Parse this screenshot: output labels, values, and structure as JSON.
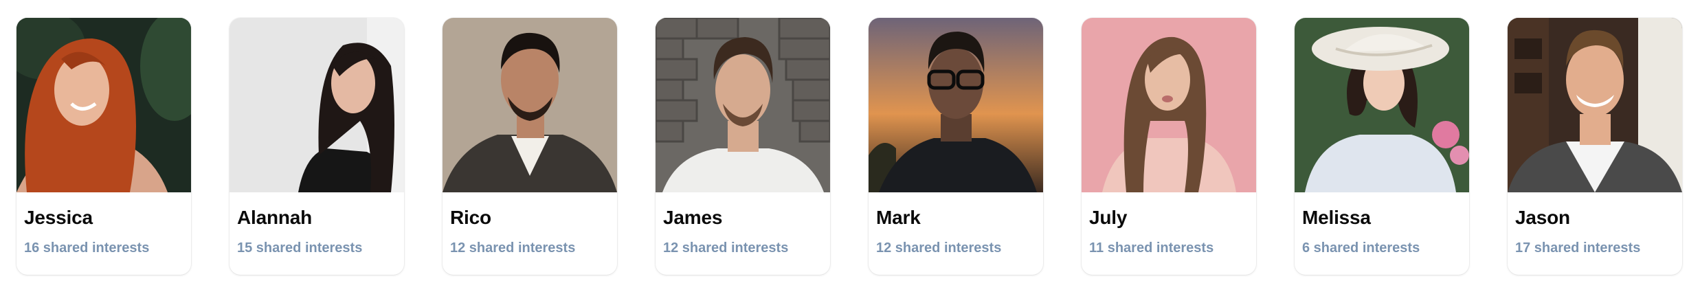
{
  "profiles": [
    {
      "name": "Jessica",
      "interests": "16 shared interests",
      "bg": "#1d2b22",
      "hair": "#b5471c",
      "skin": "#e9b79a",
      "top": "#d8a48a"
    },
    {
      "name": "Alannah",
      "interests": "15 shared interests",
      "bg": "#e6e6e6",
      "hair": "#1f1715",
      "skin": "#e4b9a3",
      "top": "#161616"
    },
    {
      "name": "Rico",
      "interests": "12 shared interests",
      "bg": "#b3a595",
      "hair": "#18120f",
      "skin": "#b98467",
      "top": "#3a3632"
    },
    {
      "name": "James",
      "interests": "12 shared interests",
      "bg": "#6b6864",
      "hair": "#3c2a1f",
      "skin": "#d6aa8f",
      "top": "#eeeeec"
    },
    {
      "name": "Mark",
      "interests": "12 shared interests",
      "bg": "#c97d45",
      "hair": "#1c1612",
      "skin": "#6b4a3a",
      "top": "#1a1c20"
    },
    {
      "name": "July",
      "interests": "11 shared interests",
      "bg": "#e9a5aa",
      "hair": "#6b4a34",
      "skin": "#e7bda4",
      "top": "#f0c6bd"
    },
    {
      "name": "Melissa",
      "interests": "6 shared interests",
      "bg": "#3d5a3a",
      "hair": "#2a1c17",
      "skin": "#efcbb6",
      "top": "#dfe5ee"
    },
    {
      "name": "Jason",
      "interests": "17 shared interests",
      "bg": "#3a2a22",
      "hair": "#6b4a2c",
      "skin": "#e2ad8d",
      "top": "#4a4a4a"
    }
  ]
}
